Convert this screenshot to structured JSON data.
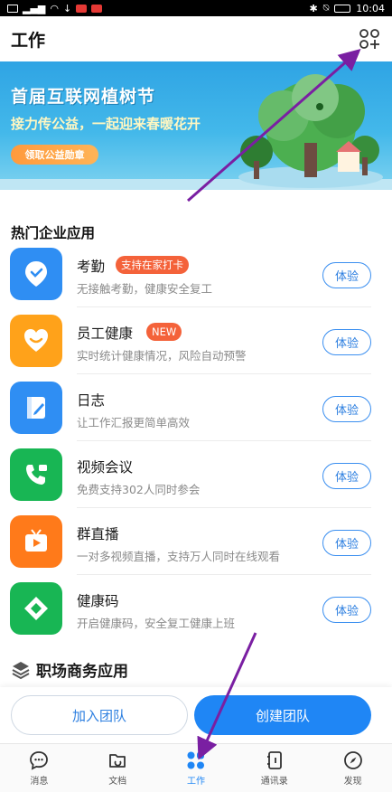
{
  "status_bar": {
    "time": "10:04"
  },
  "header": {
    "title": "工作",
    "add_icon": "add-app-icon"
  },
  "banner": {
    "title": "首届互联网植树节",
    "subtitle": "接力传公益，一起迎来春暖花开",
    "button_label": "领取公益勋章"
  },
  "hot_apps": {
    "section_title": "热门企业应用",
    "items": [
      {
        "name": "考勤",
        "badge": "支持在家打卡",
        "desc": "无接触考勤，健康安全复工",
        "button": "体验",
        "icon": "location-pin-icon",
        "color": "#2f8ef3"
      },
      {
        "name": "员工健康",
        "badge": "NEW",
        "desc": "实时统计健康情况，风险自动预警",
        "button": "体验",
        "icon": "heart-smile-icon",
        "color": "#ffa21a"
      },
      {
        "name": "日志",
        "badge": "",
        "desc": "让工作汇报更简单高效",
        "button": "体验",
        "icon": "notebook-pen-icon",
        "color": "#2f8ef3"
      },
      {
        "name": "视频会议",
        "badge": "",
        "desc": "免费支持302人同时参会",
        "button": "体验",
        "icon": "video-call-icon",
        "color": "#18b654"
      },
      {
        "name": "群直播",
        "badge": "",
        "desc": "一对多视频直播，支持万人同时在线观看",
        "button": "体验",
        "icon": "tv-live-icon",
        "color": "#ff7a1a"
      },
      {
        "name": "健康码",
        "badge": "",
        "desc": "开启健康码，安全复工健康上班",
        "button": "体验",
        "icon": "health-code-icon",
        "color": "#18b654"
      }
    ]
  },
  "business_apps": {
    "section_title": "职场商务应用"
  },
  "actions": {
    "join_team": "加入团队",
    "create_team": "创建团队"
  },
  "tabs": [
    {
      "label": "消息",
      "icon": "message-icon"
    },
    {
      "label": "文档",
      "icon": "document-icon"
    },
    {
      "label": "工作",
      "icon": "work-grid-icon"
    },
    {
      "label": "通讯录",
      "icon": "contacts-icon"
    },
    {
      "label": "发现",
      "icon": "compass-icon"
    }
  ],
  "colors": {
    "accent": "#1f86f5",
    "badge": "#f4623a",
    "annotation_arrow": "#7a1fa2"
  }
}
